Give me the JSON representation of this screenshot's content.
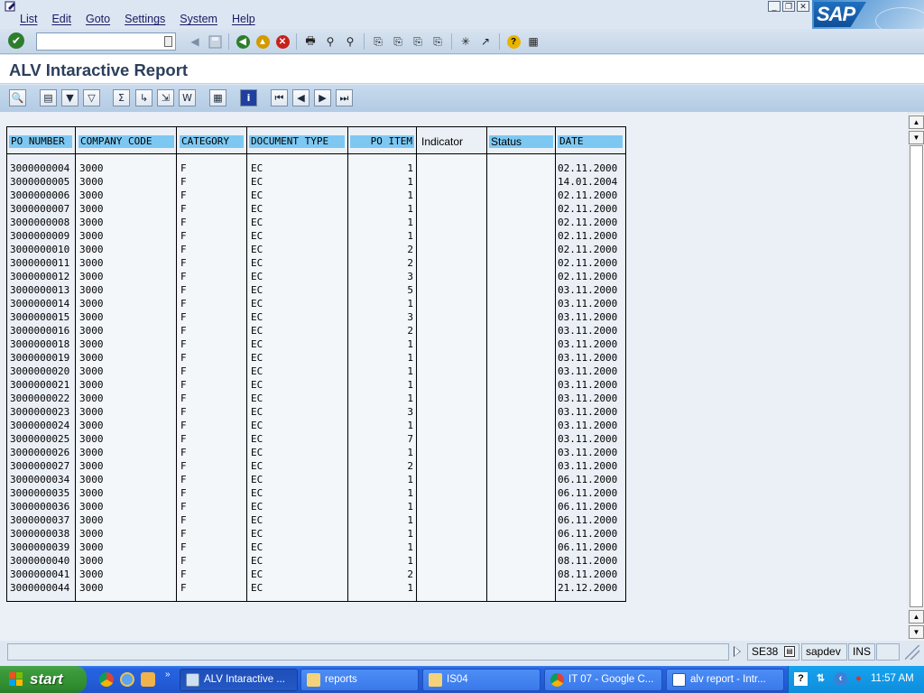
{
  "menu": {
    "items": [
      "List",
      "Edit",
      "Goto",
      "Settings",
      "System",
      "Help"
    ],
    "logo": "SAP"
  },
  "system_toolbar": {
    "command_field": {
      "value": "",
      "placeholder": ""
    },
    "icons": [
      "enter-icon",
      "back-icon",
      "exit-icon",
      "cancel-icon",
      "print-icon",
      "find-icon",
      "find-next-icon",
      "first-page-icon",
      "previous-page-icon",
      "next-page-icon",
      "last-page-icon",
      "create-session-icon",
      "shortcut-icon",
      "help-icon",
      "customize-layout-icon"
    ]
  },
  "title": "ALV Intaractive Report",
  "app_toolbar": {
    "icons": [
      "details-icon",
      "print-preview-icon",
      "set-filter-icon",
      "delete-filter-icon",
      "sum-icon",
      "subtotal-icon",
      "export-icon",
      "word-icon",
      "spreadsheet-icon",
      "layout-icon",
      "info-icon",
      "first-page-icon",
      "previous-page-icon",
      "next-page-icon",
      "last-page-icon"
    ]
  },
  "table": {
    "columns": [
      "PO NUMBER",
      "COMPANY CODE",
      "CATEGORY",
      "DOCUMENT TYPE",
      "PO ITEM",
      "Indicator",
      "Status",
      "DATE"
    ],
    "rows": [
      [
        "3000000004",
        "3000",
        "F",
        "EC",
        "1",
        "",
        "",
        "02.11.2000"
      ],
      [
        "3000000005",
        "3000",
        "F",
        "EC",
        "1",
        "",
        "",
        "14.01.2004"
      ],
      [
        "3000000006",
        "3000",
        "F",
        "EC",
        "1",
        "",
        "",
        "02.11.2000"
      ],
      [
        "3000000007",
        "3000",
        "F",
        "EC",
        "1",
        "",
        "",
        "02.11.2000"
      ],
      [
        "3000000008",
        "3000",
        "F",
        "EC",
        "1",
        "",
        "",
        "02.11.2000"
      ],
      [
        "3000000009",
        "3000",
        "F",
        "EC",
        "1",
        "",
        "",
        "02.11.2000"
      ],
      [
        "3000000010",
        "3000",
        "F",
        "EC",
        "2",
        "",
        "",
        "02.11.2000"
      ],
      [
        "3000000011",
        "3000",
        "F",
        "EC",
        "2",
        "",
        "",
        "02.11.2000"
      ],
      [
        "3000000012",
        "3000",
        "F",
        "EC",
        "3",
        "",
        "",
        "02.11.2000"
      ],
      [
        "3000000013",
        "3000",
        "F",
        "EC",
        "5",
        "",
        "",
        "03.11.2000"
      ],
      [
        "3000000014",
        "3000",
        "F",
        "EC",
        "1",
        "",
        "",
        "03.11.2000"
      ],
      [
        "3000000015",
        "3000",
        "F",
        "EC",
        "3",
        "",
        "",
        "03.11.2000"
      ],
      [
        "3000000016",
        "3000",
        "F",
        "EC",
        "2",
        "",
        "",
        "03.11.2000"
      ],
      [
        "3000000018",
        "3000",
        "F",
        "EC",
        "1",
        "",
        "",
        "03.11.2000"
      ],
      [
        "3000000019",
        "3000",
        "F",
        "EC",
        "1",
        "",
        "",
        "03.11.2000"
      ],
      [
        "3000000020",
        "3000",
        "F",
        "EC",
        "1",
        "",
        "",
        "03.11.2000"
      ],
      [
        "3000000021",
        "3000",
        "F",
        "EC",
        "1",
        "",
        "",
        "03.11.2000"
      ],
      [
        "3000000022",
        "3000",
        "F",
        "EC",
        "1",
        "",
        "",
        "03.11.2000"
      ],
      [
        "3000000023",
        "3000",
        "F",
        "EC",
        "3",
        "",
        "",
        "03.11.2000"
      ],
      [
        "3000000024",
        "3000",
        "F",
        "EC",
        "1",
        "",
        "",
        "03.11.2000"
      ],
      [
        "3000000025",
        "3000",
        "F",
        "EC",
        "7",
        "",
        "",
        "03.11.2000"
      ],
      [
        "3000000026",
        "3000",
        "F",
        "EC",
        "1",
        "",
        "",
        "03.11.2000"
      ],
      [
        "3000000027",
        "3000",
        "F",
        "EC",
        "2",
        "",
        "",
        "03.11.2000"
      ],
      [
        "3000000034",
        "3000",
        "F",
        "EC",
        "1",
        "",
        "",
        "06.11.2000"
      ],
      [
        "3000000035",
        "3000",
        "F",
        "EC",
        "1",
        "",
        "",
        "06.11.2000"
      ],
      [
        "3000000036",
        "3000",
        "F",
        "EC",
        "1",
        "",
        "",
        "06.11.2000"
      ],
      [
        "3000000037",
        "3000",
        "F",
        "EC",
        "1",
        "",
        "",
        "06.11.2000"
      ],
      [
        "3000000038",
        "3000",
        "F",
        "EC",
        "1",
        "",
        "",
        "06.11.2000"
      ],
      [
        "3000000039",
        "3000",
        "F",
        "EC",
        "1",
        "",
        "",
        "06.11.2000"
      ],
      [
        "3000000040",
        "3000",
        "F",
        "EC",
        "1",
        "",
        "",
        "08.11.2000"
      ],
      [
        "3000000041",
        "3000",
        "F",
        "EC",
        "2",
        "",
        "",
        "08.11.2000"
      ],
      [
        "3000000044",
        "3000",
        "F",
        "EC",
        "1",
        "",
        "",
        "21.12.2000"
      ]
    ]
  },
  "status_bar": {
    "message": "",
    "transaction": "SE38",
    "server": "sapdev",
    "mode": "INS"
  },
  "taskbar": {
    "start": "start",
    "tasks": [
      {
        "label": "ALV Intaractive ...",
        "icon": "sap-window-icon",
        "active": true
      },
      {
        "label": "reports",
        "icon": "folder-icon",
        "active": false
      },
      {
        "label": "IS04",
        "icon": "folder-icon",
        "active": false
      },
      {
        "label": "IT 07 - Google C...",
        "icon": "chrome-icon",
        "active": false
      },
      {
        "label": "alv report - Intr...",
        "icon": "document-icon",
        "active": false
      }
    ],
    "clock": "11:57 AM"
  }
}
